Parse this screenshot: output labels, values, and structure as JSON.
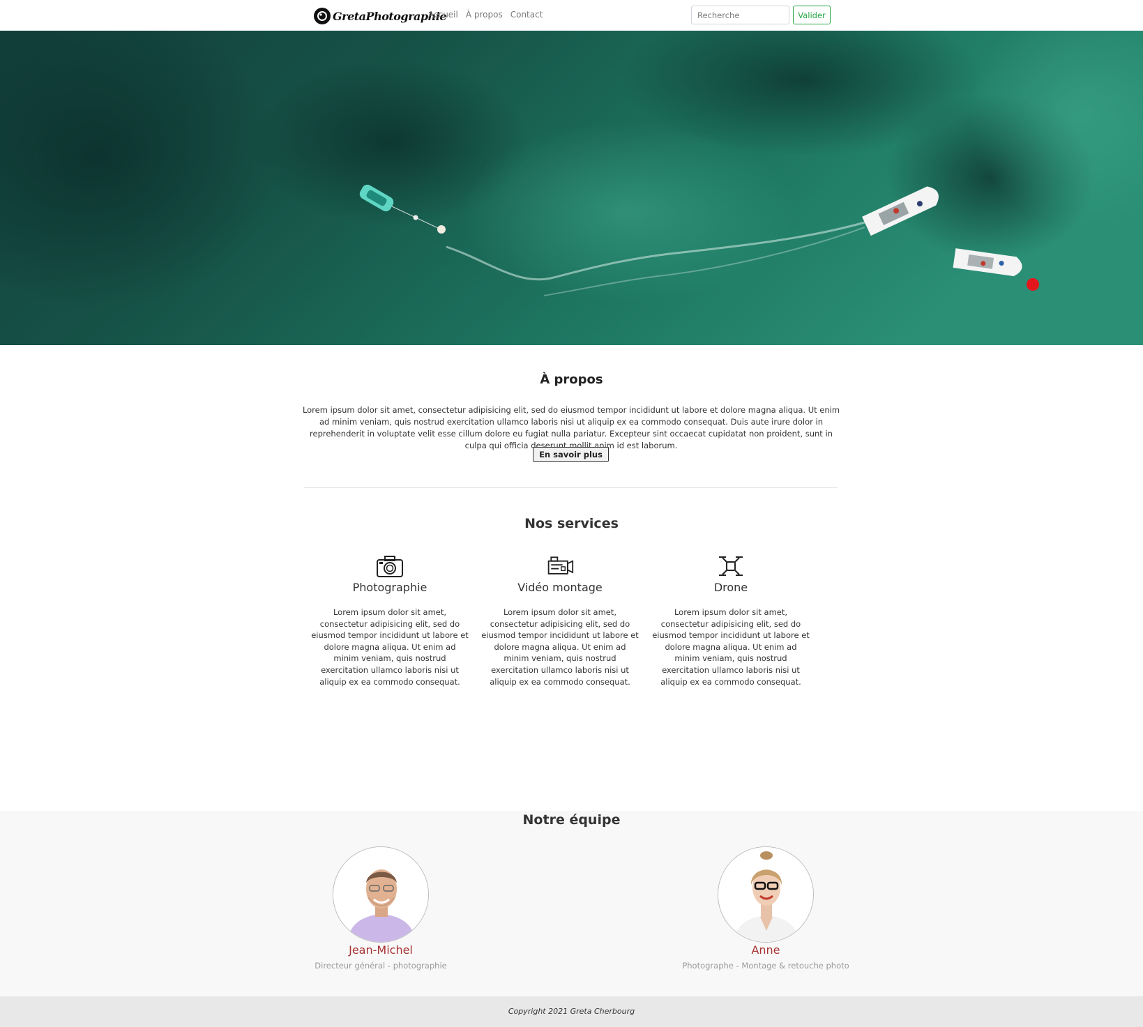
{
  "nav": {
    "brand": "GretaPhotographie",
    "links": [
      "Accueil",
      "À propos",
      "Contact"
    ],
    "search_placeholder": "Recherche",
    "search_button": "Valider"
  },
  "hero": {
    "image": "aerial-sea-boats-photo"
  },
  "about": {
    "title": "À propos",
    "text": "Lorem ipsum dolor sit amet, consectetur adipisicing elit, sed do eiusmod tempor incididunt ut labore et dolore magna aliqua. Ut enim ad minim veniam, quis nostrud exercitation ullamco laboris nisi ut aliquip ex ea commodo consequat. Duis aute irure dolor in reprehenderit in voluptate velit esse cillum dolore eu fugiat nulla pariatur. Excepteur sint occaecat cupidatat non proident, sunt in culpa qui officia deserunt mollit anim id est laborum.",
    "button": "En savoir plus"
  },
  "services": {
    "title": "Nos services",
    "items": [
      {
        "icon": "camera-icon",
        "name": "Photographie",
        "text": "Lorem ipsum dolor sit amet, consectetur adipisicing elit, sed do eiusmod tempor incididunt ut labore et dolore magna aliqua. Ut enim ad minim veniam, quis nostrud exercitation ullamco laboris nisi ut aliquip ex ea commodo consequat."
      },
      {
        "icon": "video-camera-icon",
        "name": "Vidéo montage",
        "text": "Lorem ipsum dolor sit amet, consectetur adipisicing elit, sed do eiusmod tempor incididunt ut labore et dolore magna aliqua. Ut enim ad minim veniam, quis nostrud exercitation ullamco laboris nisi ut aliquip ex ea commodo consequat."
      },
      {
        "icon": "drone-icon",
        "name": "Drone",
        "text": "Lorem ipsum dolor sit amet, consectetur adipisicing elit, sed do eiusmod tempor incididunt ut labore et dolore magna aliqua. Ut enim ad minim veniam, quis nostrud exercitation ullamco laboris nisi ut aliquip ex ea commodo consequat."
      }
    ]
  },
  "team": {
    "title": "Notre équipe",
    "members": [
      {
        "name": "Jean-Michel",
        "role": "Directeur général - photographie"
      },
      {
        "name": "Anne",
        "role": "Photographe - Montage & retouche photo"
      }
    ]
  },
  "footer": {
    "text": "Copyright 2021 Greta Cherbourg"
  },
  "colors": {
    "accent_green": "#28a745",
    "name_red": "#a83232",
    "team_bg": "#f8f8f8",
    "footer_bg": "#e8e8e8"
  }
}
